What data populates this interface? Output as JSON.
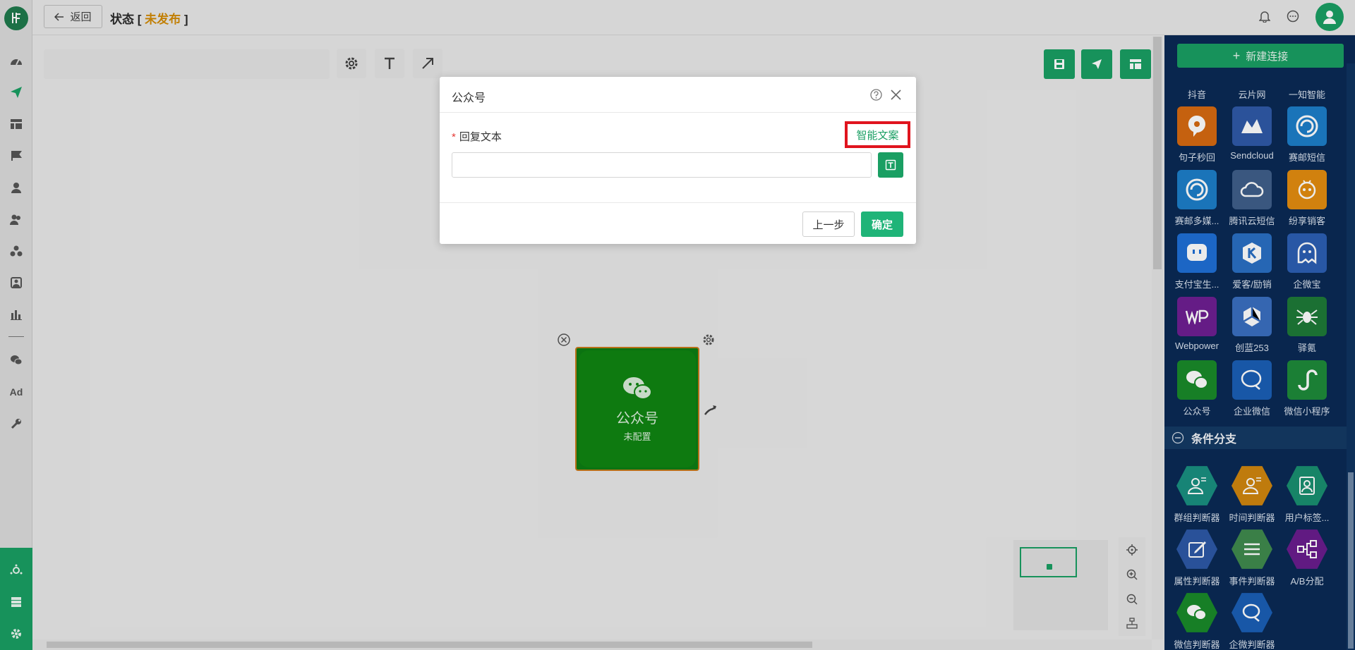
{
  "header": {
    "back_label": "返回",
    "status_prefix": "状态 [ ",
    "status_value": "未发布",
    "status_suffix": " ]"
  },
  "colors": {
    "brand_green": "#1a9f63",
    "node_green": "#108512",
    "panel_navy": "#0a2a55",
    "status_orange": "#d28a06",
    "highlight_red": "#e0141e"
  },
  "canvas": {
    "search_placeholder": "",
    "node": {
      "title": "公众号",
      "subtitle": "未配置"
    }
  },
  "right_panel": {
    "new_connection_label": "新建连接",
    "top_labels": [
      "抖音",
      "云片网",
      "一知智能"
    ],
    "connectors": [
      {
        "label": "句子秒回",
        "color": "#d66a11",
        "icon": "chat-bubble-icon"
      },
      {
        "label": "Sendcloud",
        "color": "#2f5aa8",
        "icon": "sendcloud-icon"
      },
      {
        "label": "赛邮短信",
        "color": "#1d7ec9",
        "icon": "swirl-icon"
      },
      {
        "label": "赛邮多媒...",
        "color": "#1d7ec9",
        "icon": "swirl-icon"
      },
      {
        "label": "腾讯云短信",
        "color": "#3f5f8a",
        "icon": "cloud-icon"
      },
      {
        "label": "纷享销客",
        "color": "#e38d10",
        "icon": "robot-icon"
      },
      {
        "label": "支付宝生...",
        "color": "#1f6fd6",
        "icon": "alipay-icon"
      },
      {
        "label": "爱客/励销",
        "color": "#2a6fc4",
        "icon": "k-icon"
      },
      {
        "label": "企微宝",
        "color": "#2c5fb3",
        "icon": "ghost-icon"
      },
      {
        "label": "Webpower",
        "color": "#6e1f92",
        "icon": "wp-icon"
      },
      {
        "label": "创蓝253",
        "color": "#3a6fc0",
        "icon": "cube-icon"
      },
      {
        "label": "驿氪",
        "color": "#1e7a38",
        "icon": "spider-icon"
      },
      {
        "label": "公众号",
        "color": "#1a8a2a",
        "icon": "wechat-icon"
      },
      {
        "label": "企业微信",
        "color": "#1b5fb6",
        "icon": "wecom-icon"
      },
      {
        "label": "微信小程序",
        "color": "#1e8a3a",
        "icon": "miniprogram-icon"
      }
    ],
    "branch_section_title": "条件分支",
    "branches": [
      {
        "label": "群组判断器",
        "color": "#1a9080",
        "icon": "group-user-icon"
      },
      {
        "label": "时间判断器",
        "color": "#d0860f",
        "icon": "time-user-icon"
      },
      {
        "label": "用户标签...",
        "color": "#1a9070",
        "icon": "tag-user-icon"
      },
      {
        "label": "属性判断器",
        "color": "#2d58a6",
        "icon": "edit-icon"
      },
      {
        "label": "事件判断器",
        "color": "#3f8a4e",
        "icon": "list-icon"
      },
      {
        "label": "A/B分配",
        "color": "#6a1d8e",
        "icon": "ab-split-icon"
      },
      {
        "label": "微信判断器",
        "color": "#1a8a2a",
        "icon": "wechat-icon"
      },
      {
        "label": "企微判断器",
        "color": "#1b5fb6",
        "icon": "wecom-icon"
      }
    ]
  },
  "modal": {
    "title": "公众号",
    "field_label": "回复文本",
    "required_mark": "*",
    "smart_copy_label": "智能文案",
    "reply_value": "",
    "prev_label": "上一步",
    "ok_label": "确定"
  }
}
